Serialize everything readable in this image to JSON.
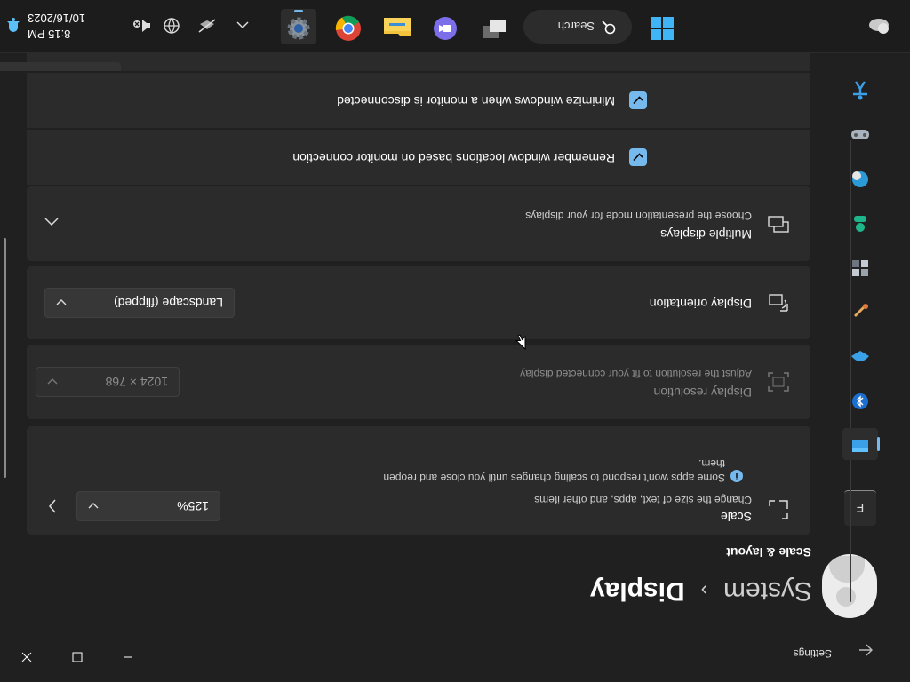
{
  "window": {
    "app_title": "Settings",
    "minimize_glyph": "—",
    "maximize_glyph": "☐",
    "close_glyph": "✕"
  },
  "nav": {
    "find_placeholder": "F",
    "items": [
      {
        "name": "system-icon"
      },
      {
        "name": "bluetooth-icon"
      },
      {
        "name": "network-icon"
      },
      {
        "name": "personalization-icon"
      },
      {
        "name": "apps-icon"
      },
      {
        "name": "accounts-icon"
      },
      {
        "name": "time-language-icon"
      },
      {
        "name": "gaming-icon"
      },
      {
        "name": "accessibility-icon"
      }
    ]
  },
  "main": {
    "breadcrumb": {
      "parent": "System",
      "separator": "›",
      "current": "Display"
    },
    "section_title": "Scale & layout",
    "scale": {
      "label": "Scale",
      "description": "Change the size of text, apps, and other items",
      "info_line1": "Some apps won't respond to scaling changes until you close and reopen",
      "info_line2": "them.",
      "value": "125%"
    },
    "resolution": {
      "label": "Display resolution",
      "description": "Adjust the resolution to fit your connected display",
      "value": "1024 × 768"
    },
    "orientation": {
      "label": "Display orientation",
      "value": "Landscape (flipped)"
    },
    "multiple_displays": {
      "label": "Multiple displays",
      "description": "Choose the presentation mode for your displays"
    },
    "remember_windows": {
      "label": "Remember window locations based on monitor connection",
      "checked": true
    },
    "minimize_windows": {
      "label": "Minimize windows when a monitor is disconnected",
      "checked": true
    }
  },
  "taskbar": {
    "search_label": "Search",
    "apps": [
      "start-icon",
      "task-view-icon",
      "teams-chat-icon",
      "file-explorer-icon",
      "chrome-icon",
      "settings-icon"
    ],
    "clock": {
      "time": "8:15 PM",
      "date": "10/16/2023"
    }
  },
  "colors": {
    "accent": "#76b9ed",
    "card": "#2b2b2b",
    "background": "#202020"
  }
}
